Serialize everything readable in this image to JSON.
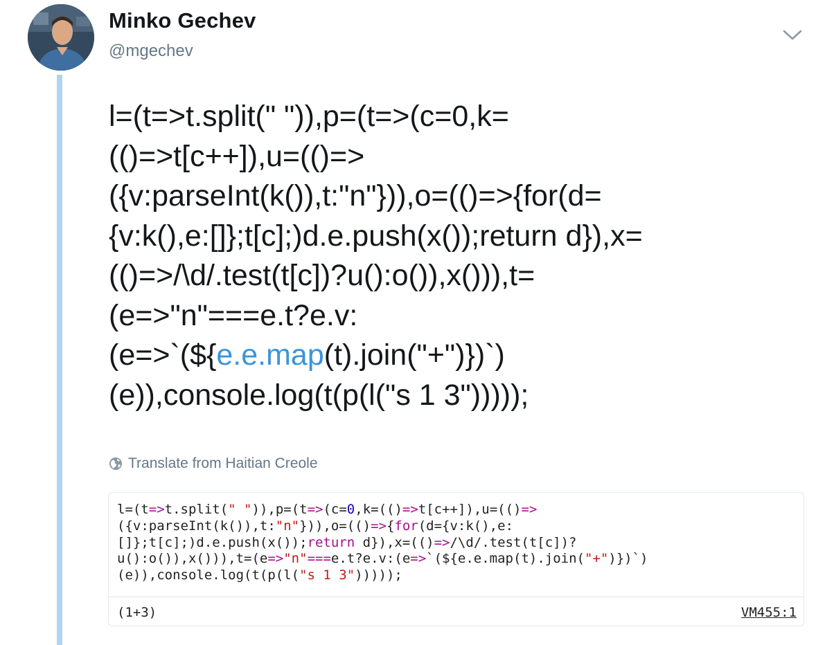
{
  "tweet": {
    "author_name": "Minko Gechev",
    "author_handle": "@mgechev",
    "text_lines": [
      "l=(t=>t.split(\" \")),p=(t=>(c=0,k=",
      "(()=>t[c++]),u=(()=>",
      "({v:parseInt(k()),t:\"n\"})),o=(()=>{for(d=",
      "{v:k(),e:[]};t[c];)d.e.push(x());return d}),x=",
      "(()=>/\\d/.test(t[c])?u():o()),x())),t=",
      "(e=>\"n\"===e.t?e.v:",
      "(e=>`(${",
      "e.e.map",
      "(t).join(\"+\")})`)",
      "(e)),console.log(t(p(l(\"s 1 3\")))));"
    ],
    "translate_label": "Translate from Haitian Creole"
  },
  "console": {
    "code_lines": [
      "l=(t=>t.split(\" \")),p=(t=>(c=0,k=(()=>t[c++]),u=(()=>",
      "({v:parseInt(k()),t:\"n\"})),o=(()=>{for(d={v:k(),e:",
      "[]};t[c];)d.e.push(x());return d}),x=(()=>/\\d/.test(t[c])?",
      "u():o()),x())),t=(e=>\"n\"===e.t?e.v:(e=>`(${e.e.map(t).join(\"+\")})`)",
      "(e)),console.log(t(p(l(\"s 1 3\")))));"
    ],
    "result": "(1+3)",
    "source": "VM455:1"
  },
  "icons": {
    "menu": "chevron-down-icon",
    "translate": "globe-icon"
  },
  "colors": {
    "link": "#3b94d9",
    "secondary_text": "#657786",
    "thread_line": "#b3d4ee",
    "keyword": "#aa0d91",
    "string": "#c41a16",
    "number": "#1c00cf"
  }
}
